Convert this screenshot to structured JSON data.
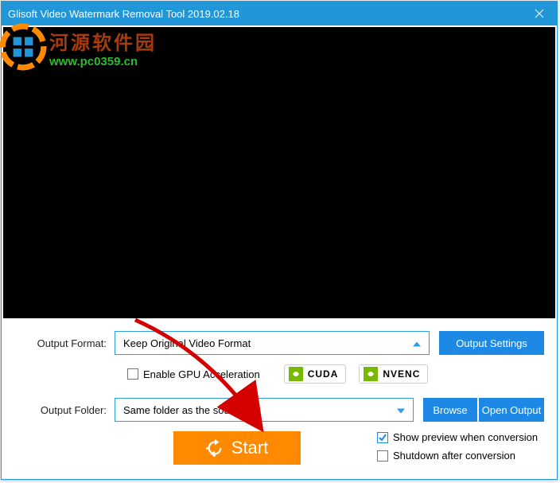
{
  "titlebar": {
    "title": "Glisoft Video Watermark Removal Tool 2019.02.18"
  },
  "watermark": {
    "chinese": "河源软件园",
    "url": "www.pc0359.cn"
  },
  "format": {
    "label": "Output Format:",
    "value": "Keep Original Video Format",
    "settings_btn": "Output Settings"
  },
  "gpu": {
    "checkbox_label": "Enable GPU Acceleration",
    "cuda": "CUDA",
    "nvenc": "NVENC"
  },
  "folder": {
    "label": "Output Folder:",
    "value": "Same folder as the source",
    "browse_btn": "Browse",
    "open_btn": "Open Output"
  },
  "actions": {
    "start": "Start"
  },
  "opts": {
    "preview": "Show preview when conversion",
    "shutdown": "Shutdown after conversion"
  }
}
